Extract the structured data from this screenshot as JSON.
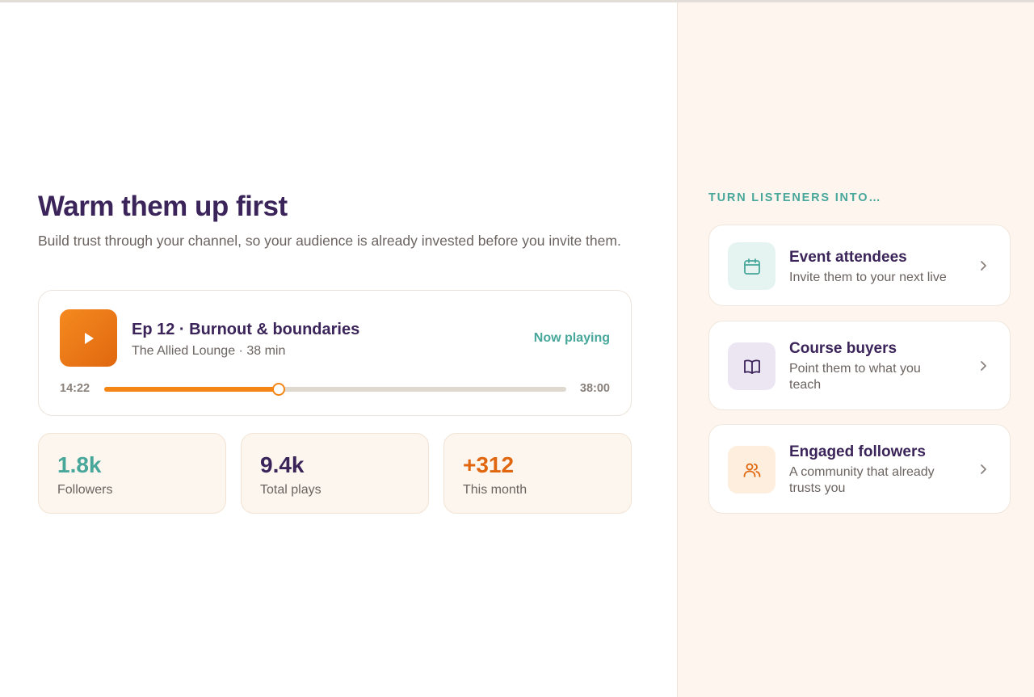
{
  "main": {
    "heading": "Warm them up first",
    "subtitle": "Build trust through your channel, so your audience is already invested before you invite them."
  },
  "player": {
    "episode_title": "Ep 12 · Burnout & boundaries",
    "meta": "The Allied Lounge · 38 min",
    "status": "Now playing",
    "current_time": "14:22",
    "total_time": "38:00",
    "progress": 0.378,
    "icon": "play-icon",
    "accent": "#f58515"
  },
  "stats": [
    {
      "value": "1.8k",
      "label": "Followers",
      "color": "#47a79a"
    },
    {
      "value": "9.4k",
      "label": "Total plays",
      "color": "#3b2459"
    },
    {
      "value": "+312",
      "label": "This month",
      "color": "#e0670f"
    }
  ],
  "sidebar": {
    "section_label": "TURN LISTENERS INTO…",
    "cards": [
      {
        "title": "Event attendees",
        "description": "Invite them to your next live",
        "icon": "calendar-icon",
        "icon_bg": "#e6f4f1",
        "icon_color": "#47a79a"
      },
      {
        "title": "Course buyers",
        "description": "Point them to what you teach",
        "icon": "book-icon",
        "icon_bg": "#ece6f3",
        "icon_color": "#3b2459"
      },
      {
        "title": "Engaged followers",
        "description": "A community that already trusts you",
        "icon": "users-icon",
        "icon_bg": "#fdeedd",
        "icon_color": "#e0670f"
      }
    ]
  }
}
